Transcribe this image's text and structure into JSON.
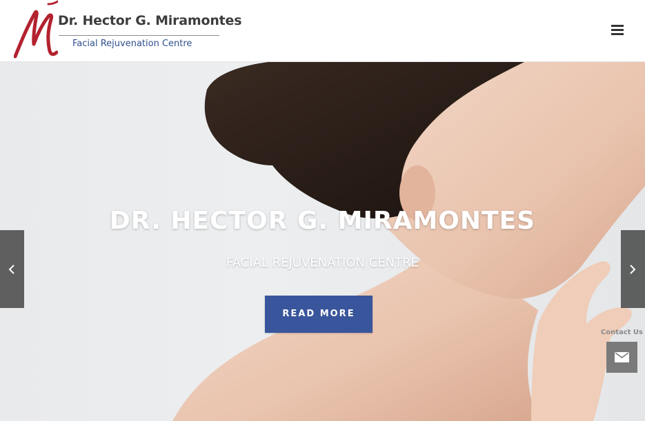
{
  "header": {
    "logo_name": "Dr. Hector G. Miramontes",
    "logo_subtitle": "Facial Rejuvenation Centre",
    "menu_icon": "hamburger-menu-icon"
  },
  "hero": {
    "title": "DR. HECTOR G. MIRAMONTES",
    "subtitle": "FACIAL REJUVENATION CENTRE",
    "cta_label": "READ MORE",
    "cta_color": "#39559b",
    "prev_icon": "chevron-left-icon",
    "next_icon": "chevron-right-icon"
  },
  "contact": {
    "label": "Contact Us",
    "icon": "envelope-icon"
  }
}
